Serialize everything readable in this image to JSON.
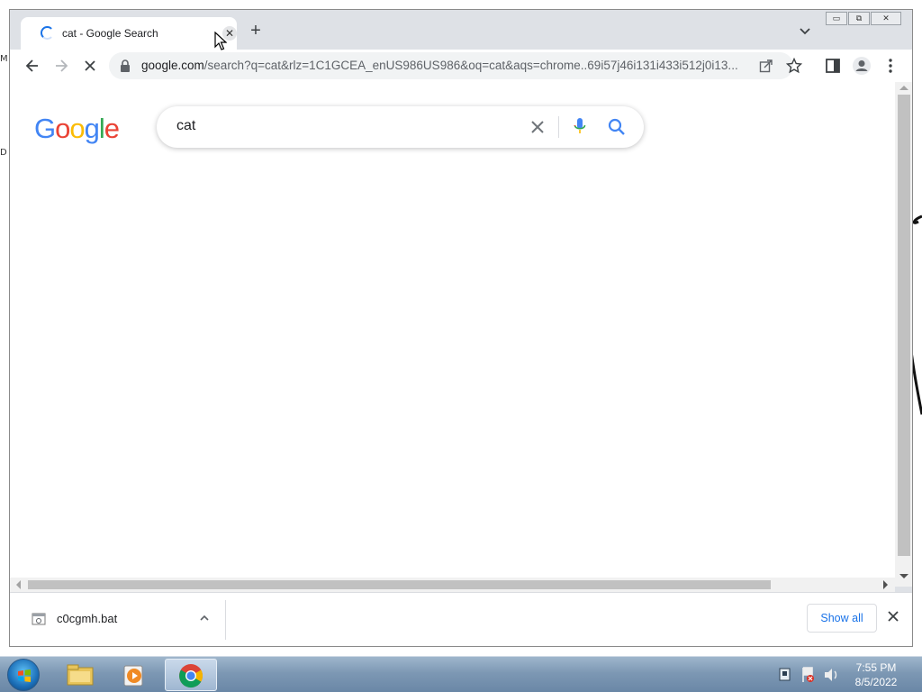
{
  "browser": {
    "tab": {
      "title": "cat - Google Search",
      "close_glyph": "✕"
    },
    "new_tab_glyph": "+",
    "window_controls": {
      "minimize": "▭",
      "maximize": "⧉",
      "close": "✕"
    },
    "address": {
      "host": "google.com",
      "rest": "/search?q=cat&rlz=1C1GCEA_enUS986US986&oq=cat&aqs=chrome..69i57j46i131i433i512j0i13..."
    }
  },
  "page": {
    "logo_letters": [
      {
        "ch": "G",
        "color": "#4285f4"
      },
      {
        "ch": "o",
        "color": "#ea4335"
      },
      {
        "ch": "o",
        "color": "#fbbc05"
      },
      {
        "ch": "g",
        "color": "#4285f4"
      },
      {
        "ch": "l",
        "color": "#34a853"
      },
      {
        "ch": "e",
        "color": "#ea4335"
      }
    ],
    "search_query": "cat"
  },
  "downloads_bar": {
    "file_name": "c0cgmh.bat",
    "show_all_label": "Show all"
  },
  "taskbar": {
    "time": "7:55 PM",
    "date": "8/5/2022",
    "pinned": [
      "windows-explorer-icon",
      "media-player-icon",
      "chrome-icon"
    ]
  },
  "colors": {
    "accent_blue": "#1a73e8",
    "tabstrip": "#dee1e6"
  }
}
